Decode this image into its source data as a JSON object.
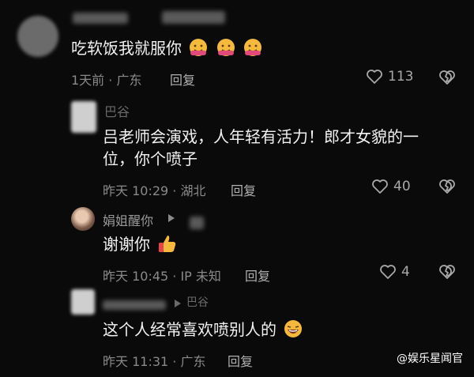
{
  "comments": [
    {
      "text": "吃软饭我就服你",
      "emojis": [
        "hugging-face-emoji",
        "hugging-face-emoji",
        "hugging-face-emoji"
      ],
      "meta": "1天前 · 广东",
      "reply_label": "回复",
      "likes": "113"
    },
    {
      "username": "巴谷",
      "text_line1": "吕老师会演戏，人年轻有活力！郎才女貌的一",
      "text_line2": "位，你个喷子",
      "meta": "昨天 10:29 · 湖北",
      "reply_label": "回复",
      "likes": "40"
    },
    {
      "username": "娟姐醒你",
      "text": "谢谢你",
      "emoji": "thumbs-up-emoji",
      "meta": "昨天 10:45 · IP 未知",
      "reply_label": "回复",
      "likes": "4"
    },
    {
      "username": "巴谷",
      "text": "这个人经常喜欢喷别人的",
      "emoji": "laughing-emoji",
      "meta": "昨天 11:31 · 广东",
      "reply_label": "回复"
    }
  ],
  "watermark": "@娱乐星闻官",
  "colors": {
    "background": "#0a0a0a",
    "text": "#f2f2f2",
    "meta": "#8a8a8a"
  }
}
